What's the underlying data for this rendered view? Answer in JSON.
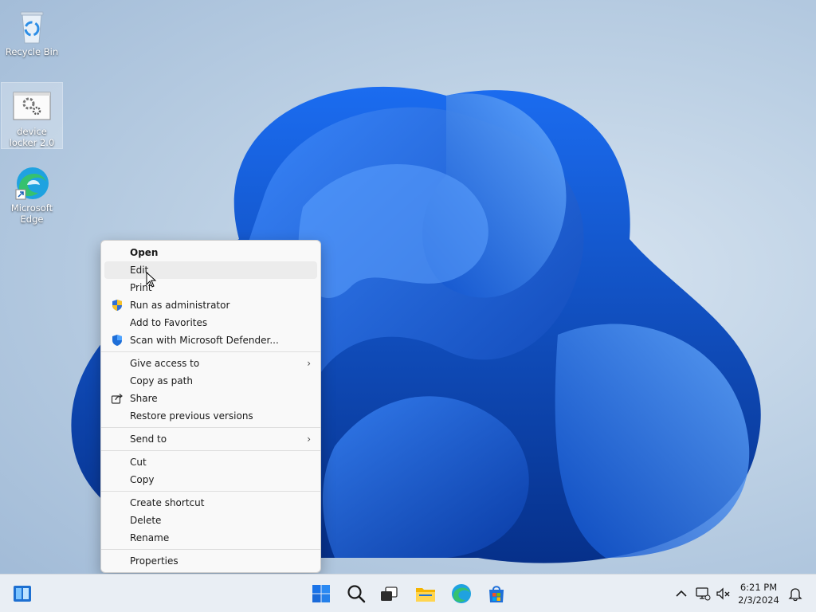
{
  "desktop": {
    "icons": [
      {
        "label": "Recycle Bin"
      },
      {
        "label": "device locker 2.0"
      },
      {
        "label": "Microsoft Edge"
      }
    ]
  },
  "context_menu": {
    "items": [
      {
        "label": "Open"
      },
      {
        "label": "Edit"
      },
      {
        "label": "Print"
      },
      {
        "label": "Run as administrator"
      },
      {
        "label": "Add to Favorites"
      },
      {
        "label": "Scan with Microsoft Defender..."
      },
      {
        "label": "Give access to"
      },
      {
        "label": "Copy as path"
      },
      {
        "label": "Share"
      },
      {
        "label": "Restore previous versions"
      },
      {
        "label": "Send to"
      },
      {
        "label": "Cut"
      },
      {
        "label": "Copy"
      },
      {
        "label": "Create shortcut"
      },
      {
        "label": "Delete"
      },
      {
        "label": "Rename"
      },
      {
        "label": "Properties"
      }
    ],
    "submenu_arrow": "›"
  },
  "taskbar": {
    "time": "6:21 PM",
    "date": "2/3/2024"
  },
  "colors": {
    "accent": "#0067c0",
    "wallpaper_blue": "#1565e0"
  }
}
